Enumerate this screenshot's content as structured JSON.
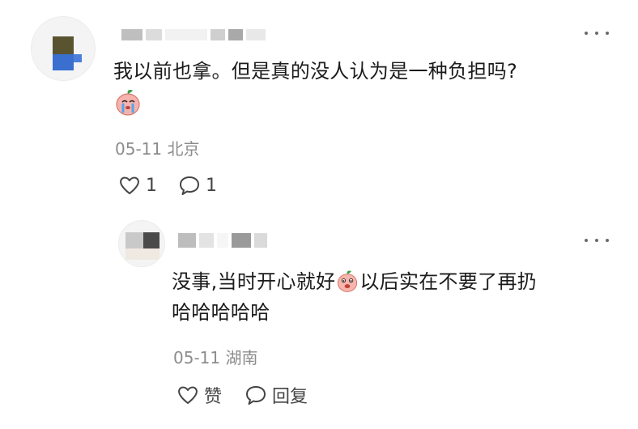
{
  "comments": [
    {
      "text": "我以前也拿。但是真的没人认为是一种负担吗?",
      "date": "05-11",
      "location": "北京",
      "like_count": "1",
      "reply_count": "1",
      "icons": {
        "more": "more-icon",
        "like": "heart-icon",
        "reply": "comment-bubble-icon",
        "emoji": "crying-peach-emoji"
      }
    },
    {
      "text_part1": "没事,当时开心就好",
      "text_part2": "以后实在不要了再扔",
      "text_line2": "哈哈哈哈哈",
      "date": "05-11",
      "location": "湖南",
      "like_label": "赞",
      "reply_label": "回复",
      "icons": {
        "more": "more-icon",
        "like": "heart-icon",
        "reply": "comment-bubble-icon",
        "emoji": "smiling-peach-emoji"
      }
    }
  ],
  "colors": {
    "text": "#1b1b1b",
    "meta": "#8c8c8c",
    "icon": "#444444"
  }
}
